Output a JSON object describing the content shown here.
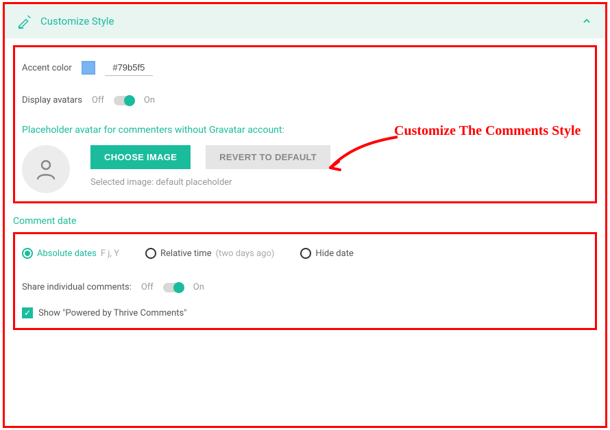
{
  "header": {
    "title": "Customize Style"
  },
  "accent": {
    "label": "Accent color",
    "hex": "#79b5f5",
    "swatch": "#79b5f5"
  },
  "avatars_toggle": {
    "label": "Display avatars",
    "off": "Off",
    "on": "On",
    "state": "on"
  },
  "placeholder": {
    "heading": "Placeholder avatar for commenters without Gravatar account:",
    "choose": "CHOOSE IMAGE",
    "revert": "REVERT TO DEFAULT",
    "selected": "Selected image: default placeholder"
  },
  "date": {
    "heading": "Comment date",
    "options": [
      {
        "label": "Absolute dates",
        "hint": "F j, Y",
        "selected": true
      },
      {
        "label": "Relative time",
        "hint": "(two days ago)",
        "selected": false
      },
      {
        "label": "Hide date",
        "hint": "",
        "selected": false
      }
    ]
  },
  "share": {
    "label": "Share individual comments:",
    "off": "Off",
    "on": "On",
    "state": "on"
  },
  "powered": {
    "label": "Show \"Powered by Thrive Comments\"",
    "checked": true
  },
  "annotation": "Customize The Comments Style"
}
